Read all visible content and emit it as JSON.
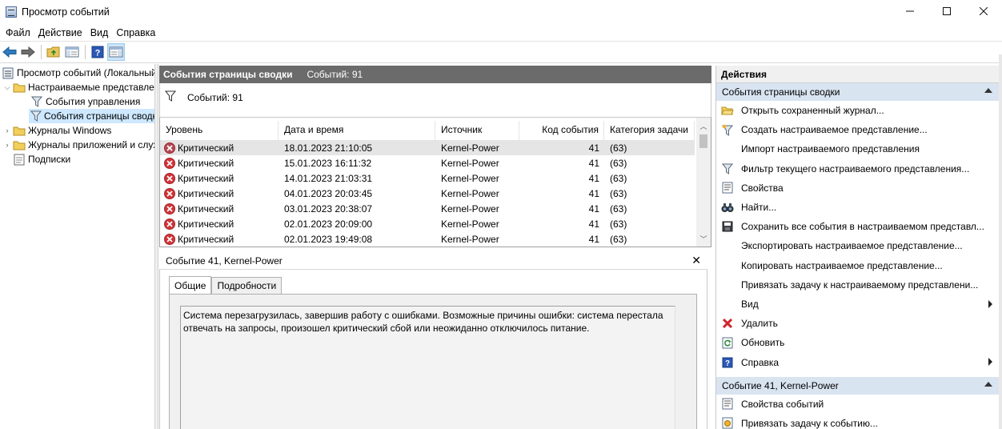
{
  "window": {
    "title": "Просмотр событий",
    "controls": {
      "minimize": "—",
      "maximize": "☐",
      "close": "✕"
    }
  },
  "menu": [
    "Файл",
    "Действие",
    "Вид",
    "Справка"
  ],
  "toolbar": [
    "back-arrow-icon",
    "forward-arrow-icon",
    "folder-up-icon",
    "show-hide-tree-icon",
    "help-icon",
    "properties-icon"
  ],
  "tree": {
    "root": "Просмотр событий (Локальный)",
    "custom_views": "Настраиваемые представления",
    "admin_events": "События управления",
    "summary_events": "События страницы сводки",
    "windows_logs": "Журналы Windows",
    "app_logs": "Журналы приложений и служб",
    "subscriptions": "Подписки"
  },
  "center": {
    "header_title": "События страницы сводки",
    "header_count": "Событий: 91",
    "filter_count": "Событий: 91",
    "columns": [
      "Уровень",
      "Дата и время",
      "Источник",
      "Код события",
      "Категория задачи"
    ],
    "rows": [
      {
        "level": "Критический",
        "datetime": "18.01.2023 21:10:05",
        "source": "Kernel-Power",
        "code": "41",
        "category": "(63)"
      },
      {
        "level": "Критический",
        "datetime": "15.01.2023 16:11:32",
        "source": "Kernel-Power",
        "code": "41",
        "category": "(63)"
      },
      {
        "level": "Критический",
        "datetime": "14.01.2023 21:03:31",
        "source": "Kernel-Power",
        "code": "41",
        "category": "(63)"
      },
      {
        "level": "Критический",
        "datetime": "04.01.2023 20:03:45",
        "source": "Kernel-Power",
        "code": "41",
        "category": "(63)"
      },
      {
        "level": "Критический",
        "datetime": "03.01.2023 20:38:07",
        "source": "Kernel-Power",
        "code": "41",
        "category": "(63)"
      },
      {
        "level": "Критический",
        "datetime": "02.01.2023 20:09:00",
        "source": "Kernel-Power",
        "code": "41",
        "category": "(63)"
      },
      {
        "level": "Критический",
        "datetime": "02.01.2023 19:49:08",
        "source": "Kernel-Power",
        "code": "41",
        "category": "(63)"
      }
    ]
  },
  "detail": {
    "title": "Событие 41, Kernel-Power",
    "close": "✕",
    "tabs": [
      "Общие",
      "Подробности"
    ],
    "message": "Система перезагрузилась, завершив работу с ошибками. Возможные причины ошибки: система перестала отвечать на запросы, произошел критический сбой или неожиданно отключилось питание."
  },
  "actions": {
    "title": "Действия",
    "group1": "События страницы сводки",
    "items": [
      {
        "label": "Открыть сохраненный журнал...",
        "icon": "open-folder-icon"
      },
      {
        "label": "Создать настраиваемое представление...",
        "icon": "create-filter-icon"
      },
      {
        "label": "Импорт настраиваемого представления",
        "icon": ""
      },
      {
        "label": "Фильтр текущего настраиваемого представления...",
        "icon": "filter-icon"
      },
      {
        "label": "Свойства",
        "icon": "properties-icon"
      },
      {
        "label": "Найти...",
        "icon": "find-binoculars-icon"
      },
      {
        "label": "Сохранить все события в настраиваемом представл...",
        "icon": "save-icon"
      },
      {
        "label": "Экспортировать настраиваемое представление...",
        "icon": ""
      },
      {
        "label": "Копировать настраиваемое представление...",
        "icon": ""
      },
      {
        "label": "Привязать задачу к настраиваемому представлени...",
        "icon": ""
      },
      {
        "label": "Вид",
        "icon": "",
        "submenu": true
      },
      {
        "label": "Удалить",
        "icon": "delete-icon"
      },
      {
        "label": "Обновить",
        "icon": "refresh-icon"
      },
      {
        "label": "Справка",
        "icon": "help-icon",
        "submenu": true
      }
    ],
    "group2": "Событие 41, Kernel-Power",
    "items2": [
      {
        "label": "Свойства событий",
        "icon": "properties-icon"
      },
      {
        "label": "Привязать задачу к событию...",
        "icon": "task-icon"
      }
    ]
  }
}
